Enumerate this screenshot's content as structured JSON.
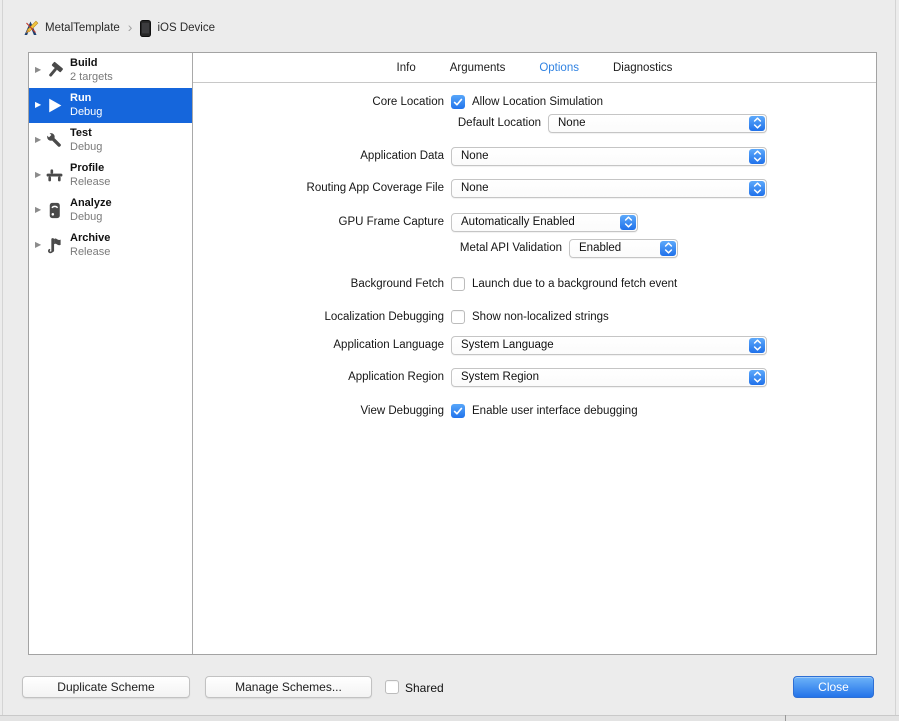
{
  "breadcrumb": {
    "project": "MetalTemplate",
    "separator": "›",
    "device": "iOS Device"
  },
  "sidebar": {
    "items": [
      {
        "title": "Build",
        "subtitle": "2 targets",
        "icon": "hammer-icon",
        "selected": false
      },
      {
        "title": "Run",
        "subtitle": "Debug",
        "icon": "play-icon",
        "selected": true
      },
      {
        "title": "Test",
        "subtitle": "Debug",
        "icon": "wrench-icon",
        "selected": false
      },
      {
        "title": "Profile",
        "subtitle": "Release",
        "icon": "gauge-icon",
        "selected": false
      },
      {
        "title": "Analyze",
        "subtitle": "Debug",
        "icon": "analyze-icon",
        "selected": false
      },
      {
        "title": "Archive",
        "subtitle": "Release",
        "icon": "archive-icon",
        "selected": false
      }
    ]
  },
  "tabs": [
    {
      "label": "Info",
      "selected": false
    },
    {
      "label": "Arguments",
      "selected": false
    },
    {
      "label": "Options",
      "selected": true
    },
    {
      "label": "Diagnostics",
      "selected": false
    }
  ],
  "form": {
    "core_location": {
      "label": "Core Location",
      "checkbox_label": "Allow Location Simulation",
      "checked": true
    },
    "default_location": {
      "label": "Default Location",
      "value": "None"
    },
    "application_data": {
      "label": "Application Data",
      "value": "None"
    },
    "routing_app_coverage": {
      "label": "Routing App Coverage File",
      "value": "None"
    },
    "gpu_frame_capture": {
      "label": "GPU Frame Capture",
      "value": "Automatically Enabled"
    },
    "metal_api_validation": {
      "label": "Metal API Validation",
      "value": "Enabled"
    },
    "background_fetch": {
      "label": "Background Fetch",
      "checkbox_label": "Launch due to a background fetch event",
      "checked": false
    },
    "localization_debugging": {
      "label": "Localization Debugging",
      "checkbox_label": "Show non-localized strings",
      "checked": false
    },
    "application_language": {
      "label": "Application Language",
      "value": "System Language"
    },
    "application_region": {
      "label": "Application Region",
      "value": "System Region"
    },
    "view_debugging": {
      "label": "View Debugging",
      "checkbox_label": "Enable user interface debugging",
      "checked": true
    }
  },
  "footer": {
    "duplicate_button": "Duplicate Scheme",
    "manage_button": "Manage Schemes...",
    "shared_label": "Shared",
    "shared_checked": false,
    "close_button": "Close"
  },
  "colors": {
    "selection_blue": "#1566dc",
    "control_blue_top": "#5da9fb",
    "control_blue_bottom": "#2071ea",
    "tab_active_blue": "#3183e2",
    "panel_border": "#a3a3a3",
    "background": "#ececec"
  }
}
